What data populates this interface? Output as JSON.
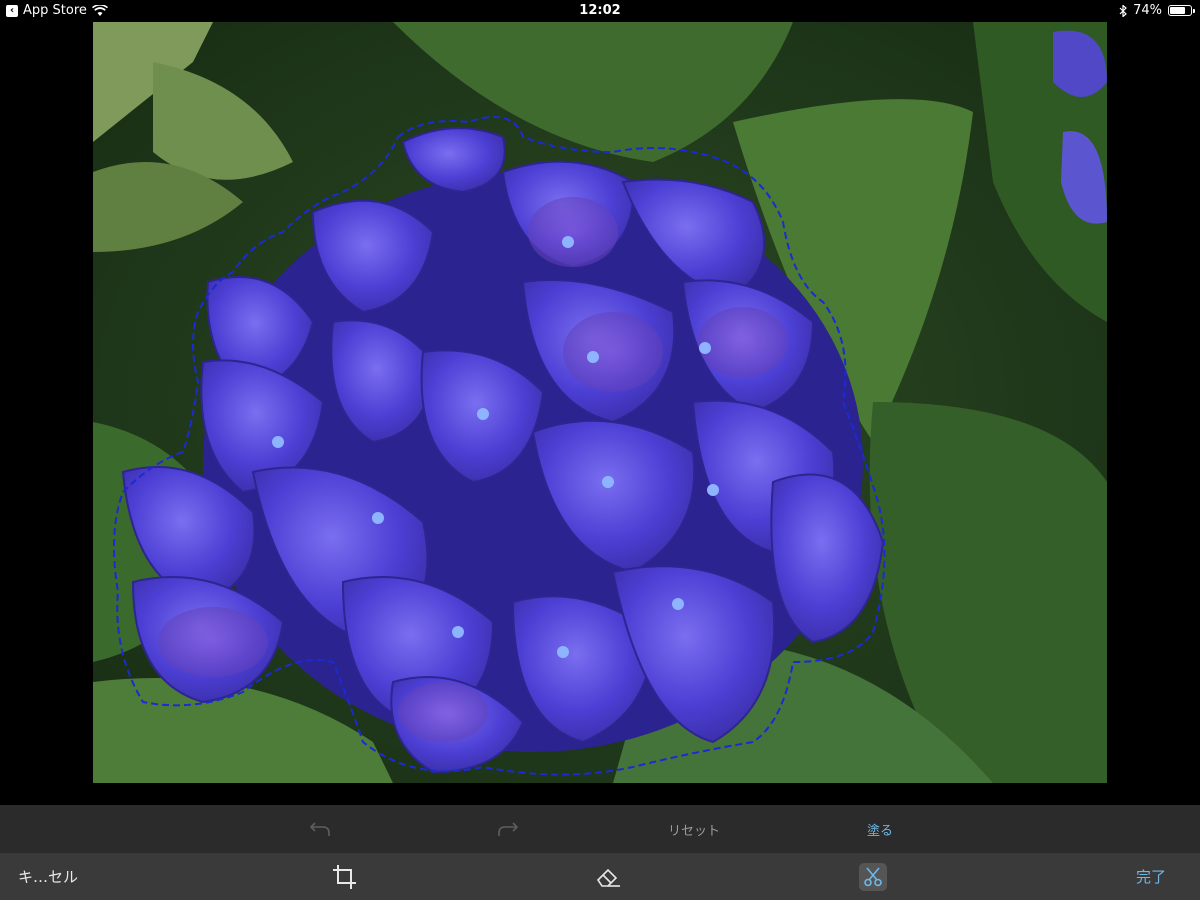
{
  "status_bar": {
    "back_app": "App Store",
    "time": "12:02",
    "battery_percent": "74%",
    "battery_level": 0.74,
    "icons": [
      "back-arrow-icon",
      "wifi-icon",
      "bluetooth-icon",
      "battery-icon"
    ]
  },
  "photo": {
    "icons": [
      "lasso-selection-path"
    ],
    "colors": {
      "selection_stroke": "#1a2bd6",
      "petal": "#5a4fe0",
      "leaf": "#3d6b2a"
    }
  },
  "edit_bar": {
    "reset_label": "リセット",
    "paint_label": "塗る",
    "icons": [
      "undo-icon",
      "redo-icon"
    ]
  },
  "bottom_bar": {
    "cancel_label": "キ…セル",
    "done_label": "完了",
    "icons": [
      "crop-icon",
      "eraser-icon",
      "scissors-icon"
    ]
  },
  "colors": {
    "accent": "#6cb8e8",
    "toolbar_top": "#2b2b2b",
    "toolbar_bottom": "#3a3a3a",
    "disabled": "#7a7a7a"
  }
}
